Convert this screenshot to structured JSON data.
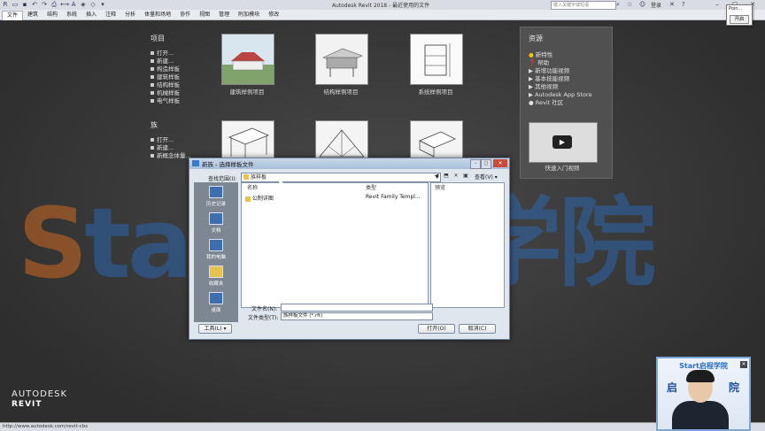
{
  "window": {
    "title": "Autodesk Revit 2018 -",
    "subtitle": "最近使用的文件",
    "search_placeholder": "键入关键字或短语",
    "signin": "登录"
  },
  "ribbon": {
    "tabs": [
      "建筑",
      "结构",
      "系统",
      "插入",
      "注释",
      "分析",
      "体量和场地",
      "协作",
      "视图",
      "管理",
      "附加模块",
      "修改"
    ],
    "file_tab": "文件"
  },
  "start": {
    "projects_heading": "项目",
    "project_links": [
      "打开...",
      "新建...",
      "构造样板",
      "建筑样板",
      "结构样板",
      "机械样板",
      "电气样板"
    ],
    "families_heading": "族",
    "family_links": [
      "打开...",
      "新建...",
      "新概念体量..."
    ],
    "project_samples": [
      "建筑样例项目",
      "结构样例项目",
      "系统样例项目"
    ],
    "resources_heading": "资源",
    "resource_links": [
      "新特性",
      "帮助",
      "新增功能视频",
      "基本技能视频",
      "其他视频",
      "Autodesk App Store",
      "Revit 社区"
    ],
    "video_label": "快速入门视频"
  },
  "popup": {
    "title": "Poin...",
    "button": "开启"
  },
  "watermark": {
    "text_a": "S",
    "text_b": "tart启程学院"
  },
  "logo": {
    "line1": "AUTODESK",
    "line2": "REVIT"
  },
  "status": {
    "text": "http://www.autodesk.com/revit-cbs"
  },
  "dialog": {
    "title": "新族 - 选择样板文件",
    "lookin_label": "查找范围(I):",
    "lookin_value": "族样板",
    "preview_label": "预览",
    "places": [
      "历史记录",
      "文档",
      "我的电脑",
      "收藏夹",
      "桌面"
    ],
    "columns": {
      "name": "名称",
      "type": "类型"
    },
    "files": [
      {
        "name": "公制详图",
        "type": "Revit Family Templ..."
      }
    ],
    "filename_label": "文件名(N):",
    "filename_value": "",
    "filetype_label": "文件类型(T):",
    "filetype_value": "族样板文件 (*.rft)",
    "tools": "工具(L)",
    "open": "打开(O)",
    "cancel": "取消(C)",
    "views": "查看(V)"
  },
  "webcam": {
    "banner": "Start启程学院",
    "c1": "启",
    "c2": "院"
  }
}
